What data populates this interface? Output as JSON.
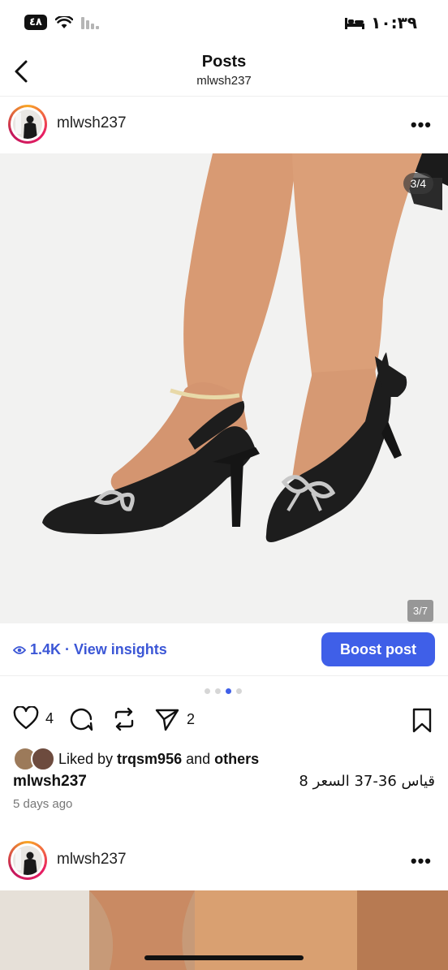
{
  "status_bar": {
    "battery": "٤٨",
    "time": "١٠:٣٩"
  },
  "header": {
    "title": "Posts",
    "subtitle": "mlwsh237"
  },
  "post": {
    "username": "mlwsh237",
    "carousel_counter": "3/4",
    "image_counter": "3/7",
    "views": "1.4K",
    "insights_label": "· View insights",
    "boost_label": "Boost post",
    "carousel_dots": 4,
    "active_dot": 3,
    "likes_count": "4",
    "shares_count": "2",
    "liked_by_prefix": "Liked by ",
    "liked_by_user": "trqsm956",
    "liked_by_mid": " and ",
    "liked_by_others": "others",
    "caption_user": "mlwsh237",
    "caption_text": "قياس 36-37 السعر 8",
    "posted_ago": "5 days ago"
  },
  "next_post": {
    "username": "mlwsh237"
  },
  "colors": {
    "accent": "#3f5fe8",
    "insights_text": "#3c57d6",
    "muted": "#777777"
  }
}
